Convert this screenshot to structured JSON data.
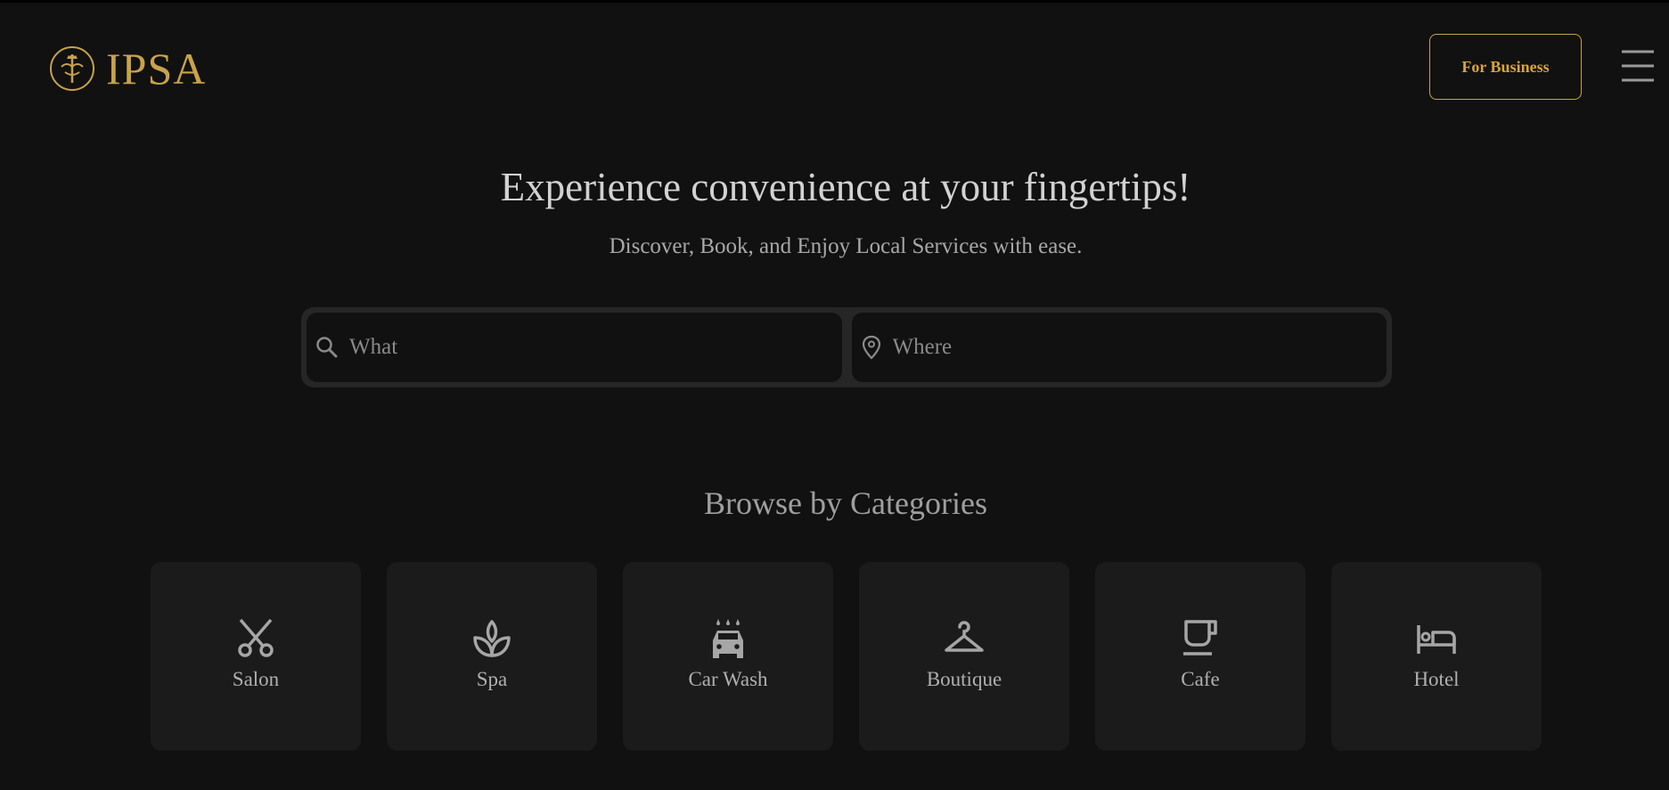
{
  "header": {
    "logo_text": "IPSA",
    "business_button": "For Business"
  },
  "hero": {
    "title": "Experience convenience at your fingertips!",
    "subtitle": "Discover, Book, and Enjoy Local Services with ease."
  },
  "search": {
    "what_placeholder": "What",
    "where_placeholder": "Where"
  },
  "categories": {
    "heading": "Browse by Categories",
    "items": [
      {
        "label": "Salon",
        "icon": "scissors-icon"
      },
      {
        "label": "Spa",
        "icon": "lotus-icon"
      },
      {
        "label": "Car Wash",
        "icon": "car-wash-icon"
      },
      {
        "label": "Boutique",
        "icon": "hanger-icon"
      },
      {
        "label": "Cafe",
        "icon": "coffee-cup-icon"
      },
      {
        "label": "Hotel",
        "icon": "bed-icon"
      }
    ]
  },
  "colors": {
    "background": "#111111",
    "accent_gold": "#c9a24a",
    "card": "#1b1b1b",
    "search_frame": "#262626"
  }
}
